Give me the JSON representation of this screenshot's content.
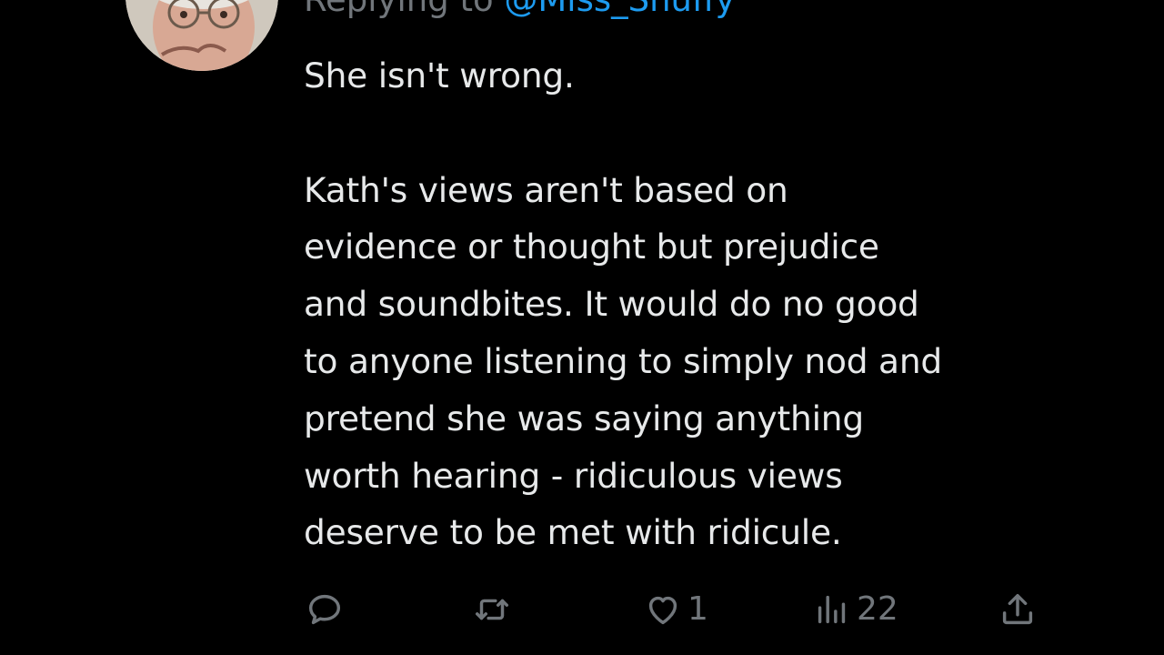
{
  "tweet": {
    "replying_prefix": "Replying to ",
    "replying_handle": "@Miss_Snuffy",
    "body": "She isn't wrong.\n\nKath's views aren't based on\nevidence or thought but prejudice\nand soundbites. It would do no good\nto anyone listening to simply nod and\npretend she was saying anything\nworth hearing - ridiculous views\ndeserve to be met with ridicule."
  },
  "actions": {
    "reply_icon": "reply-icon",
    "retweet_icon": "retweet-icon",
    "like_icon": "heart-icon",
    "like_count": "1",
    "views_icon": "views-icon",
    "views_count": "22",
    "share_icon": "share-icon"
  },
  "colors": {
    "background": "#000000",
    "text": "#e7e9ea",
    "muted": "#71767b",
    "link": "#1d9bf0"
  }
}
